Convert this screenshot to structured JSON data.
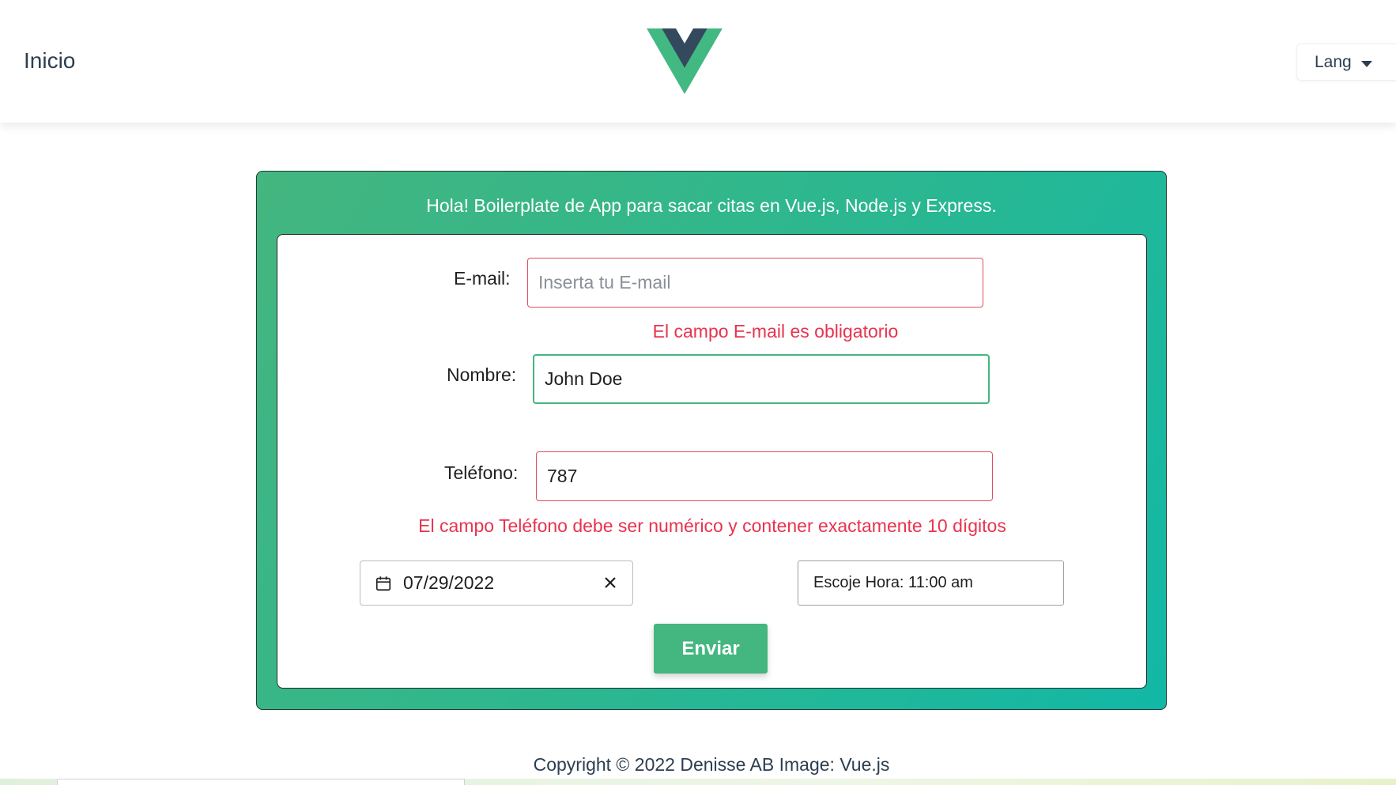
{
  "header": {
    "home_link": "Inicio",
    "lang_label": "Lang"
  },
  "card": {
    "title": "Hola! Boilerplate de App para sacar citas en Vue.js, Node.js y Express."
  },
  "form": {
    "email_label": "E-mail:",
    "email_placeholder": "Inserta tu E-mail",
    "email_value": "",
    "email_error": "El campo E-mail es obligatorio",
    "name_label": "Nombre:",
    "name_value": "John Doe",
    "phone_label": "Teléfono:",
    "phone_value": "787",
    "phone_error": "El campo Teléfono debe ser numérico y contener exactamente 10 dígitos",
    "date_value": "07/29/2022",
    "time_text": "Escoje Hora: 11:00 am",
    "submit_label": "Enviar"
  },
  "footer": {
    "copyright": "Copyright © 2022 Denisse AB Image: Vue.js"
  },
  "colors": {
    "vue_green": "#42b883",
    "vue_dark": "#35495e",
    "error_red": "#e8334f",
    "gradient_start": "#44b67f",
    "gradient_end": "#12b8a6"
  }
}
